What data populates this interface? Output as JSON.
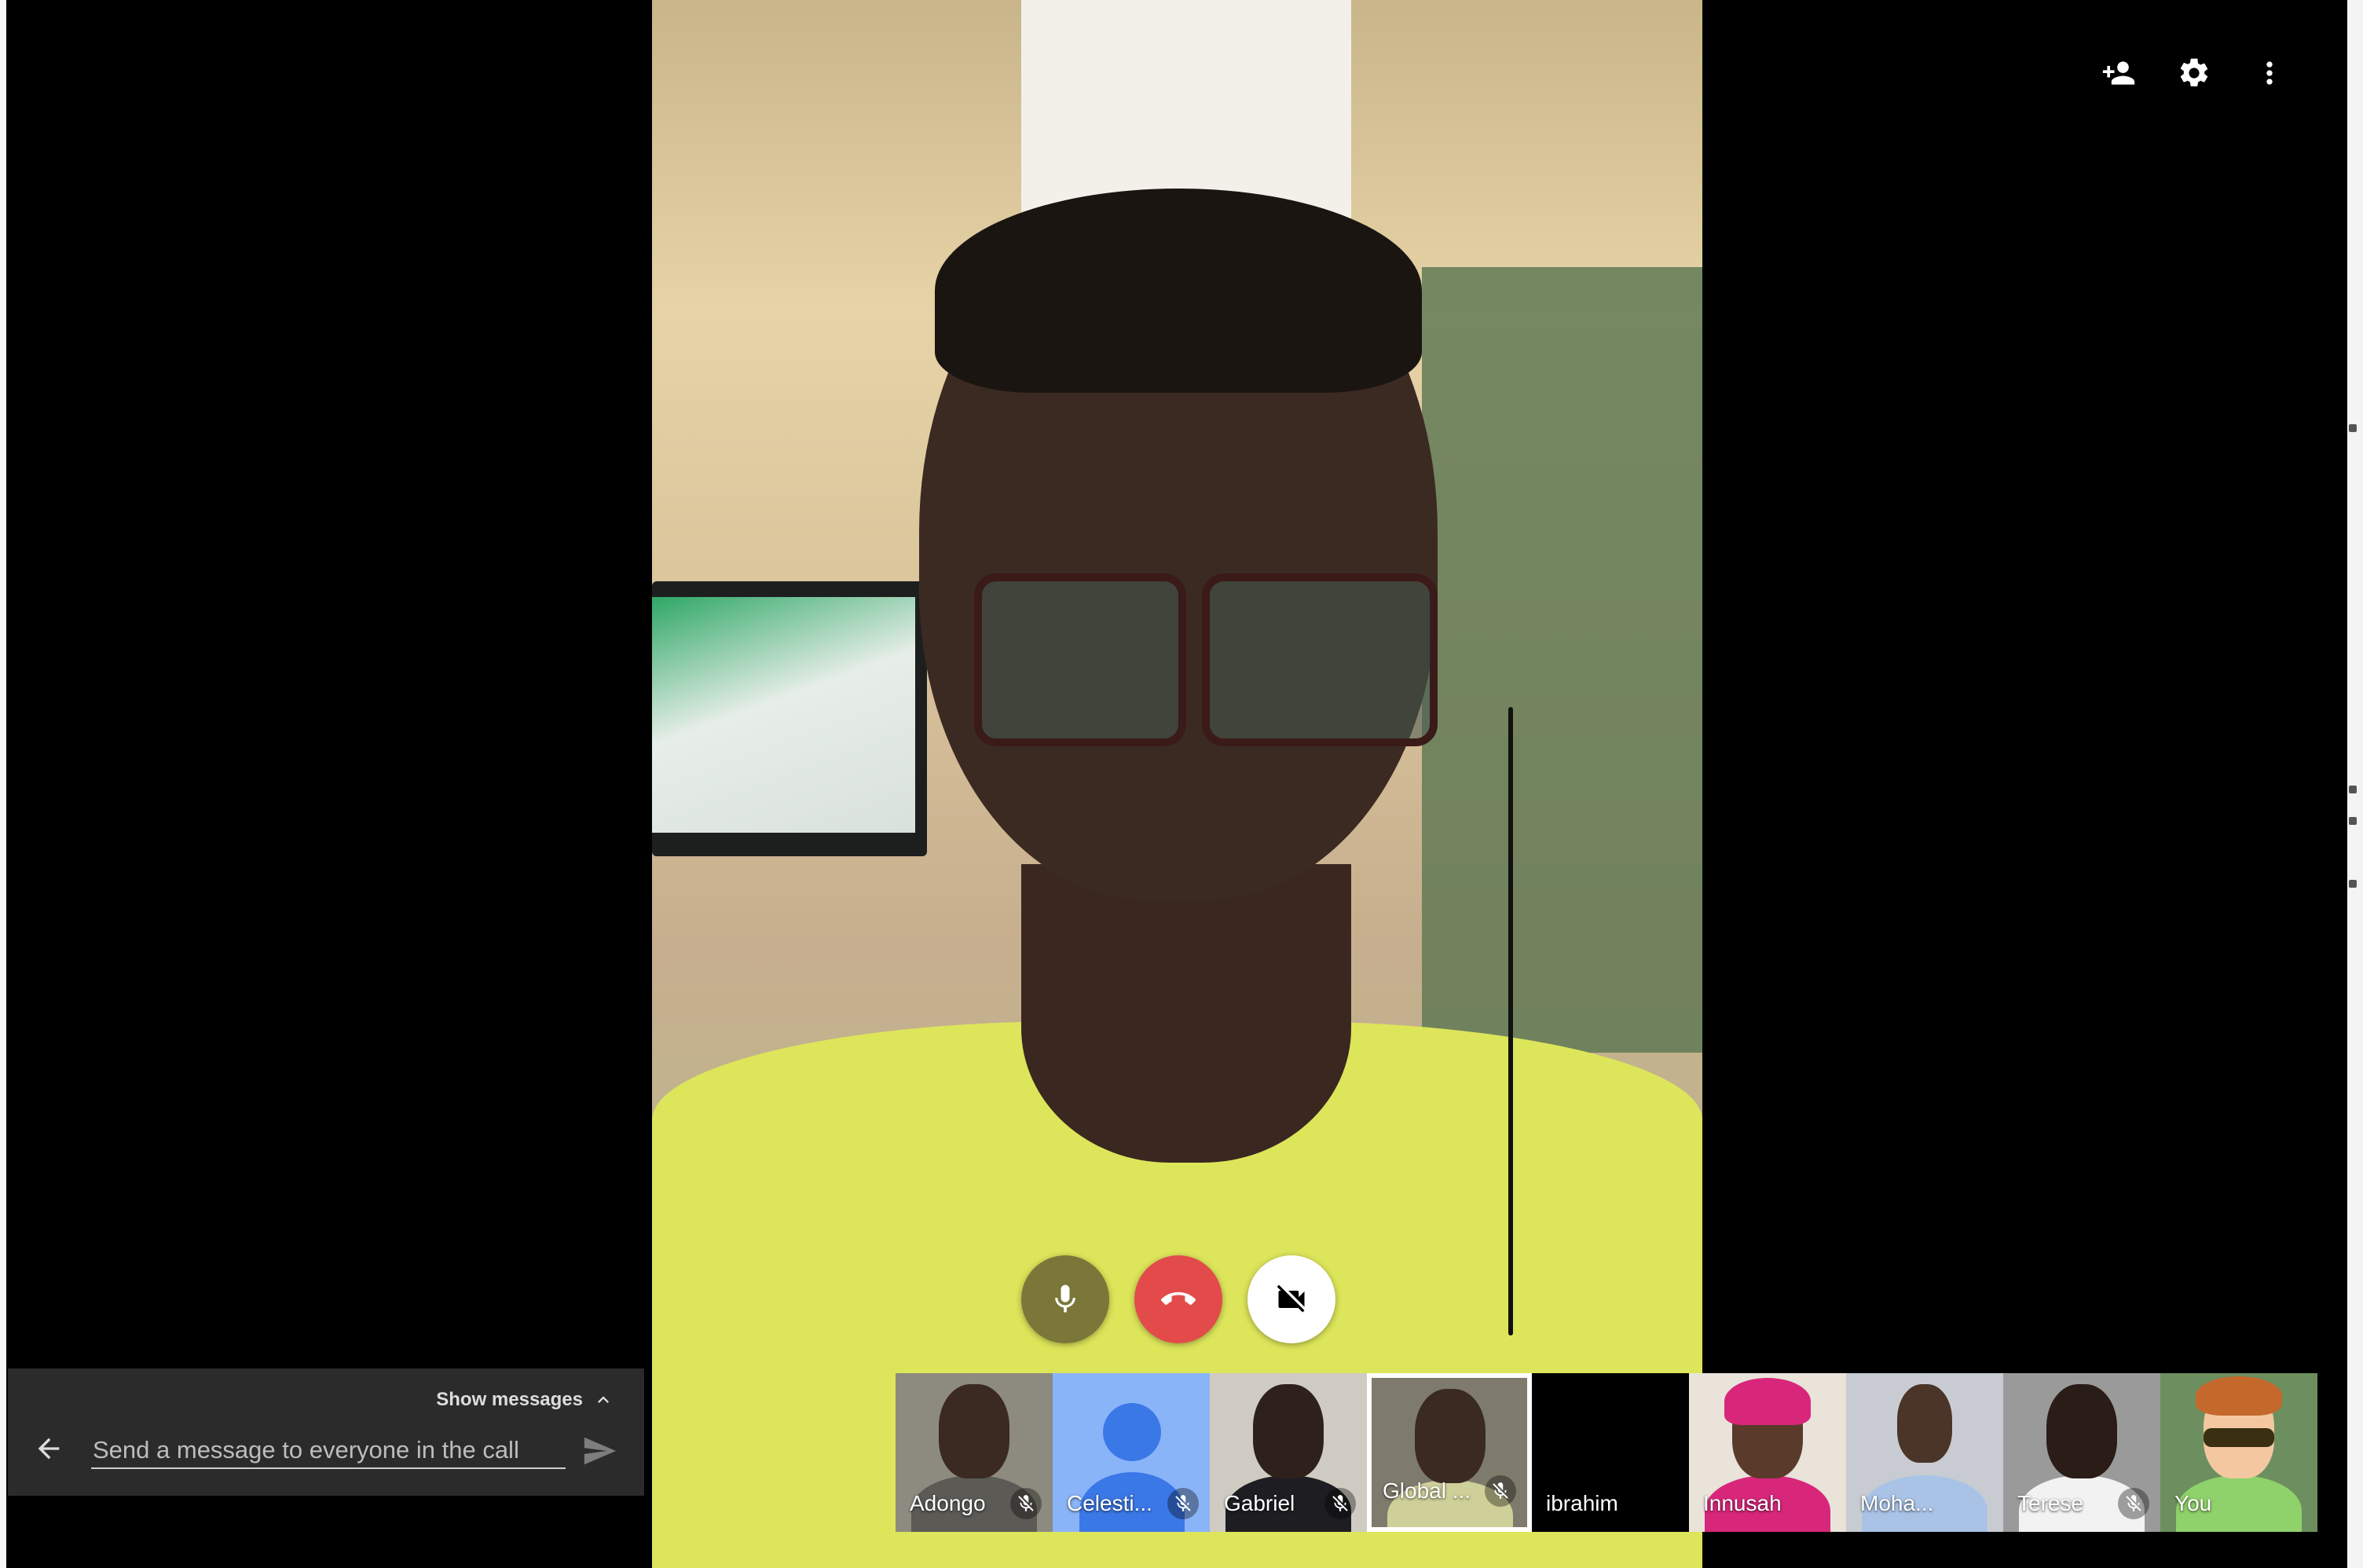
{
  "top_controls": {
    "add_people_icon": "person-add-icon",
    "settings_icon": "gear-icon",
    "more_icon": "more-vert-icon"
  },
  "call_controls": {
    "mic_icon": "mic-icon",
    "end_call_icon": "end-call-icon",
    "camera_off_icon": "camera-off-icon",
    "end_call_color": "#e34b4b"
  },
  "chat": {
    "show_messages_label": "Show messages",
    "input_placeholder": "Send a message to everyone in the call"
  },
  "participants": [
    {
      "name": "Adongo",
      "muted": true
    },
    {
      "name": "Celesti...",
      "muted": true
    },
    {
      "name": "Gabriel",
      "muted": true
    },
    {
      "name": "Global ...",
      "muted": true,
      "selected": true
    },
    {
      "name": "ibrahim",
      "muted": false
    },
    {
      "name": "Innusah",
      "muted": false
    },
    {
      "name": "Moha...",
      "muted": false
    },
    {
      "name": "Terese",
      "muted": true
    },
    {
      "name": "You",
      "muted": false
    }
  ]
}
